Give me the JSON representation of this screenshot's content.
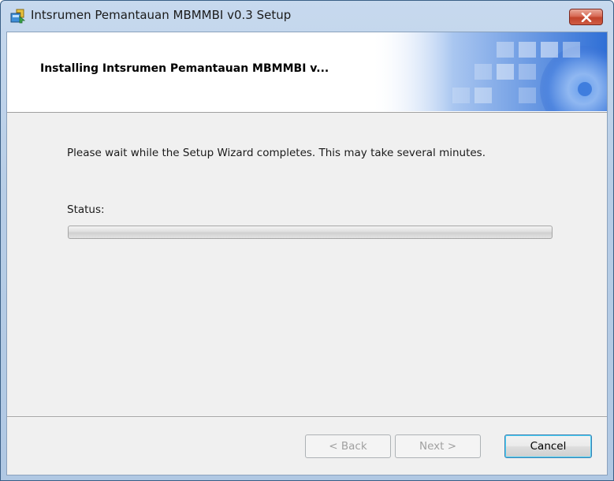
{
  "window": {
    "title": "Intsrumen Pemantauan MBMMBI v0.3 Setup",
    "icon": "installer-icon",
    "close_icon": "close-icon"
  },
  "header": {
    "title": "Installing Intsrumen Pemantauan MBMMBI v..."
  },
  "main": {
    "description": "Please wait while the Setup Wizard completes.  This may take several minutes.",
    "status_label": "Status:",
    "progress_fraction": 0
  },
  "buttons": {
    "back_label": "< Back",
    "next_label": "Next >",
    "cancel_label": "Cancel"
  },
  "colors": {
    "accent": "#3c7fb1",
    "close": "#c2442c"
  }
}
